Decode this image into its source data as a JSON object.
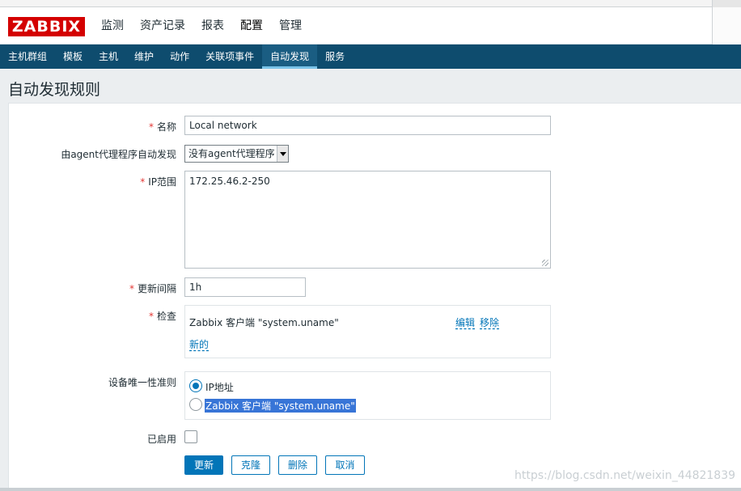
{
  "app": {
    "logo_text": "ZABBIX"
  },
  "main_menu": [
    {
      "label": "监测"
    },
    {
      "label": "资产记录"
    },
    {
      "label": "报表"
    },
    {
      "label": "配置",
      "active": true
    },
    {
      "label": "管理"
    }
  ],
  "sub_menu": [
    {
      "label": "主机群组"
    },
    {
      "label": "模板"
    },
    {
      "label": "主机"
    },
    {
      "label": "维护"
    },
    {
      "label": "动作"
    },
    {
      "label": "关联项事件"
    },
    {
      "label": "自动发现",
      "active": true
    },
    {
      "label": "服务"
    }
  ],
  "page": {
    "title": "自动发现规则"
  },
  "form": {
    "name": {
      "label": "名称",
      "required_mark": "*",
      "value": "Local network"
    },
    "proxy": {
      "label": "由agent代理程序自动发现",
      "value": "没有agent代理程序"
    },
    "ip_range": {
      "label": "IP范围",
      "required_mark": "*",
      "value": "172.25.46.2-250"
    },
    "interval": {
      "label": "更新间隔",
      "required_mark": "*",
      "value": "1h"
    },
    "checks": {
      "label": "检查",
      "required_mark": "*",
      "items": [
        {
          "text": "Zabbix 客户端 \"system.uname\"",
          "edit_label": "编辑",
          "remove_label": "移除"
        }
      ],
      "new_label": "新的"
    },
    "uniqueness": {
      "label": "设备唯一性准则",
      "options": [
        {
          "label": "IP地址",
          "selected": true
        },
        {
          "label": "Zabbix 客户端 \"system.uname\"",
          "selected": false
        }
      ]
    },
    "enabled": {
      "label": "已启用",
      "checked": false
    }
  },
  "buttons": {
    "update": "更新",
    "clone": "克隆",
    "delete": "删除",
    "cancel": "取消"
  },
  "watermark": "https://blog.csdn.net/weixin_44821839",
  "colors": {
    "accent": "#0275b8",
    "nav_bg": "#0e4c6e",
    "logo_red": "#d40000",
    "required": "#e33734"
  }
}
